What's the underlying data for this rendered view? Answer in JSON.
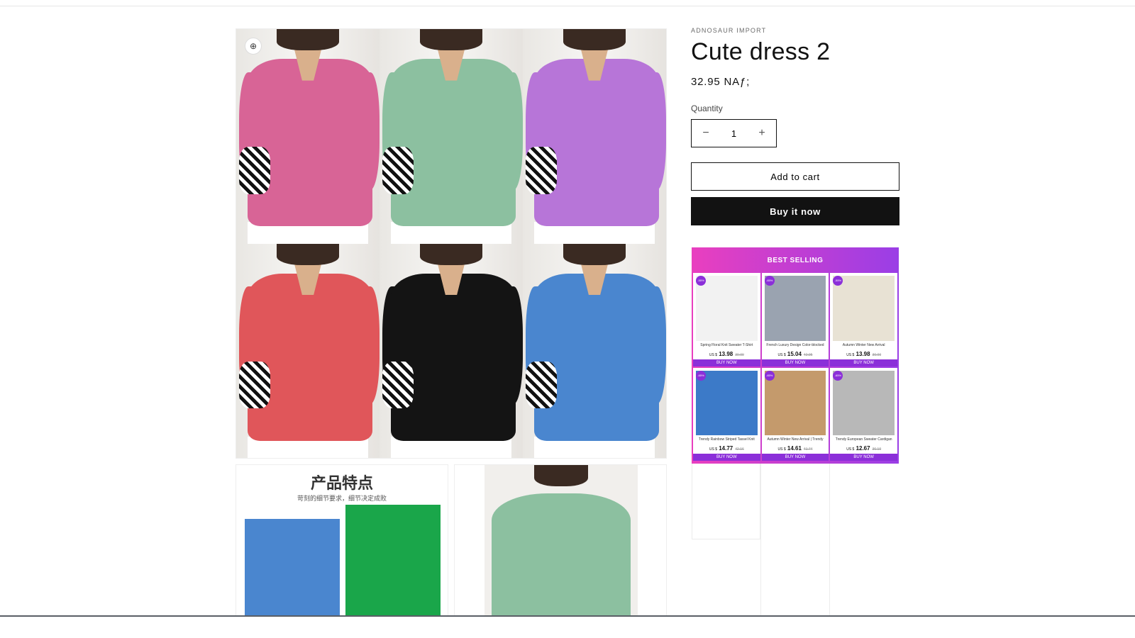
{
  "product": {
    "vendor": "ADNOSAUR IMPORT",
    "title": "Cute dress 2",
    "price": "32.95 NAƒ;",
    "quantity_label": "Quantity",
    "quantity_value": "1",
    "decrease_symbol": "−",
    "increase_symbol": "+",
    "add_to_cart": "Add to cart",
    "buy_now": "Buy it now"
  },
  "gallery": {
    "zoom_icon": "zoom-icon",
    "main_tiles": [
      {
        "color": "#d86496"
      },
      {
        "color": "#8cc0a0"
      },
      {
        "color": "#b775d8"
      },
      {
        "color": "#e0565a"
      },
      {
        "color": "#141414"
      },
      {
        "color": "#4a86cf"
      }
    ],
    "feature_title": "产品特点",
    "feature_subtitle": "苛刻的细节要求，细节决定成败",
    "feature_colors": [
      "#4a86cf",
      "#1aa64a"
    ],
    "second_color": "#8cc0a0"
  },
  "promo": {
    "heading": "BEST SELLING",
    "items": [
      {
        "name": "Spring Floral Knit Sweater T-Shirt",
        "currency": "US $",
        "price": "13.98",
        "old": "30.00",
        "button": "BUY NOW",
        "badge": "-55%",
        "color": "#f2f2f2"
      },
      {
        "name": "French Luxury Design Color-blocked",
        "currency": "US $",
        "price": "15.04",
        "old": "42.95",
        "button": "BUY NOW",
        "badge": "-65%",
        "color": "#9aa3b0"
      },
      {
        "name": "Autumn Winter New Arrival",
        "currency": "US $",
        "price": "13.98",
        "old": "30.00",
        "button": "BUY NOW",
        "badge": "-55%",
        "color": "#e8e2d4"
      },
      {
        "name": "Trendy Rainbow Striped Tassel Knit",
        "currency": "US $",
        "price": "14.77",
        "old": "42.16",
        "button": "BUY NOW",
        "badge": "-65%",
        "color": "#3c7ac8"
      },
      {
        "name": "Autumn Winter New Arrival | Trendy",
        "currency": "US $",
        "price": "14.61",
        "old": "41.74",
        "button": "BUY NOW",
        "badge": "-65%",
        "color": "#c49a6c"
      },
      {
        "name": "Trendy European Sweater Cardigan",
        "currency": "US $",
        "price": "12.67",
        "old": "36.19",
        "button": "BUY NOW",
        "badge": "-65%",
        "color": "#b8b8b8"
      }
    ]
  }
}
